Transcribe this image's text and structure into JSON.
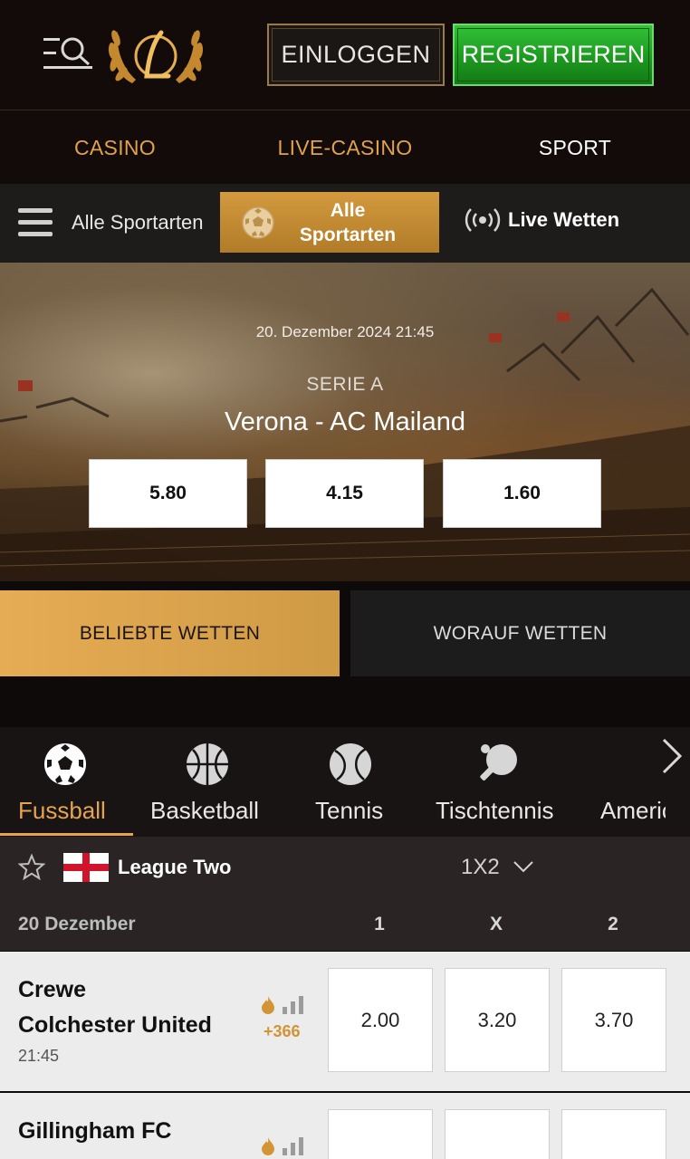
{
  "header": {
    "menu_icon": "menu-search-icon",
    "logo_icon": "laurel-logo-icon",
    "login_label": "EINLOGGEN",
    "register_label": "REGISTRIEREN",
    "colors": {
      "gold": "#e0a24c",
      "green": "#1c9a1f",
      "background": "#120b09"
    }
  },
  "main_nav": {
    "items": [
      {
        "label": "CASINO"
      },
      {
        "label": "LIVE-CASINO"
      },
      {
        "label": "SPORT"
      }
    ],
    "active": "SPORT"
  },
  "sub_nav": {
    "all_sports_label": "Alle Sportarten",
    "active_button_line1": "Alle",
    "active_button_line2": "Sportarten",
    "live_label": "Live Wetten"
  },
  "hero": {
    "date": "20. Dezember 2024 21:45",
    "league": "SERIE A",
    "teams": "Verona  -  AC Mailand",
    "odds": [
      "5.80",
      "4.15",
      "1.60"
    ]
  },
  "tabs": {
    "popular": "BELIEBTE WETTEN",
    "what_to_bet": "WORAUF WETTEN"
  },
  "sports": {
    "items": [
      {
        "label": "Fussball",
        "icon": "soccer-ball-icon"
      },
      {
        "label": "Basketball",
        "icon": "basketball-icon"
      },
      {
        "label": "Tennis",
        "icon": "tennis-ball-icon"
      },
      {
        "label": "Tischtennis",
        "icon": "table-tennis-icon"
      },
      {
        "label": "Americ"
      }
    ],
    "active": "Fussball"
  },
  "league": {
    "name": "League Two",
    "market": "1X2",
    "date": "20 Dezember",
    "columns": [
      "1",
      "X",
      "2"
    ]
  },
  "matches": [
    {
      "home": "Crewe",
      "away": "Colchester United",
      "time": "21:45",
      "more": "+366",
      "odds": [
        "2.00",
        "3.20",
        "3.70"
      ]
    },
    {
      "home": "Gillingham FC",
      "away": "",
      "time": "",
      "more": "",
      "odds": [
        "",
        "",
        ""
      ]
    }
  ]
}
